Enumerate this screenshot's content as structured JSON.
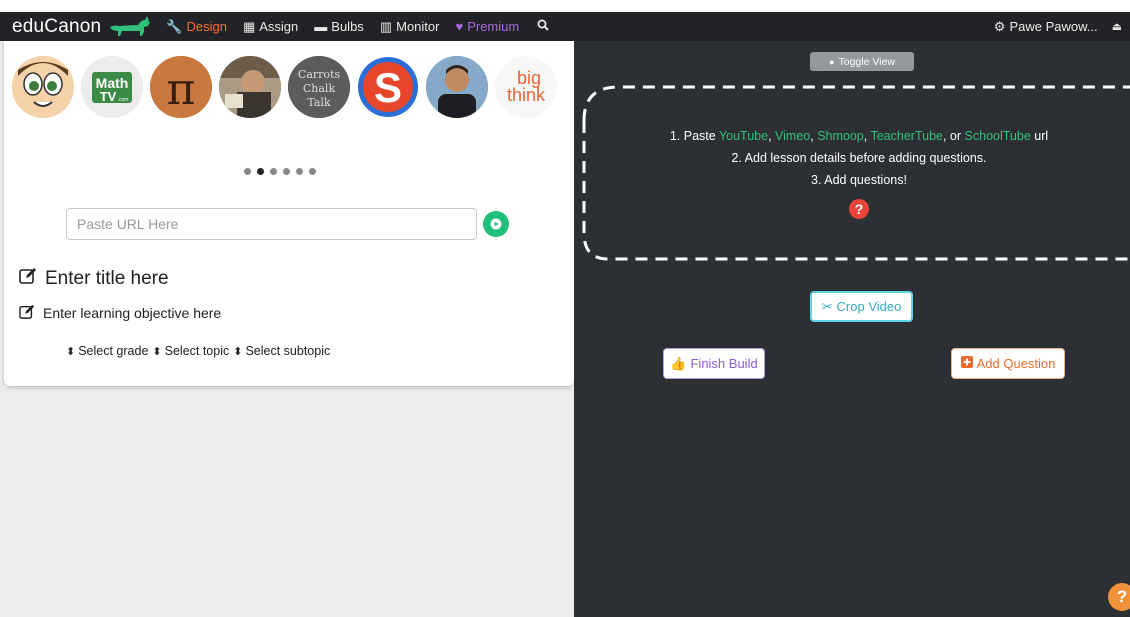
{
  "navbar": {
    "brand": "eduCanon",
    "items": [
      {
        "label": "Design",
        "icon": "wrench-icon"
      },
      {
        "label": "Assign",
        "icon": "calendar-icon"
      },
      {
        "label": "Bulbs",
        "icon": "briefcase-icon"
      },
      {
        "label": "Monitor",
        "icon": "bar-chart-icon"
      },
      {
        "label": "Premium",
        "icon": "heart-icon"
      }
    ],
    "user_name": "Pawe Pawow...",
    "colors": {
      "background": "#222326",
      "active": "#ff6a3d",
      "premium": "#a56ad8"
    }
  },
  "left": {
    "providers": [
      "sal-khan",
      "mathtv",
      "pi",
      "photo",
      "carrots-chalk-talk",
      "shmoop",
      "teacher",
      "big-think"
    ],
    "provider_text": {
      "mathtv": "Math",
      "mathtv_sub": "TV",
      "mathtv_com": ".com",
      "pi": "π",
      "chalk_1": "Carrots",
      "chalk_2": "Chalk",
      "chalk_3": "Talk",
      "shmoop": "S",
      "bigthink_1": "big",
      "bigthink_2": "think"
    },
    "url_placeholder": "Paste URL Here",
    "title_placeholder": "Enter title here",
    "objective_placeholder": "Enter learning objective here",
    "selects": [
      {
        "label": "Select grade"
      },
      {
        "label": "Select topic"
      },
      {
        "label": "Select subtopic"
      }
    ],
    "accent_color": "#1fbf7a"
  },
  "right": {
    "toggle_label": "Toggle View",
    "instructions": {
      "line1_prefix": "1. Paste ",
      "youtube": "YouTube",
      "vimeo": "Vimeo",
      "shmoop": "Shmoop",
      "teachertube": "TeacherTube",
      "or": ", or ",
      "schooltube": "SchoolTube",
      "line1_suffix": " url",
      "sep": ", ",
      "line2": "2. Add lesson details before adding questions.",
      "line3": "3. Add questions!"
    },
    "qmark": "?",
    "crop_label": "Crop Video",
    "finish_label": "Finish Build",
    "add_question_label": "Add Question",
    "help": "?",
    "colors": {
      "background": "#2c2f33",
      "link": "#30c17a",
      "crop": "#37a9c7",
      "finish": "#8b5bd6",
      "add": "#ea6b2f"
    }
  }
}
